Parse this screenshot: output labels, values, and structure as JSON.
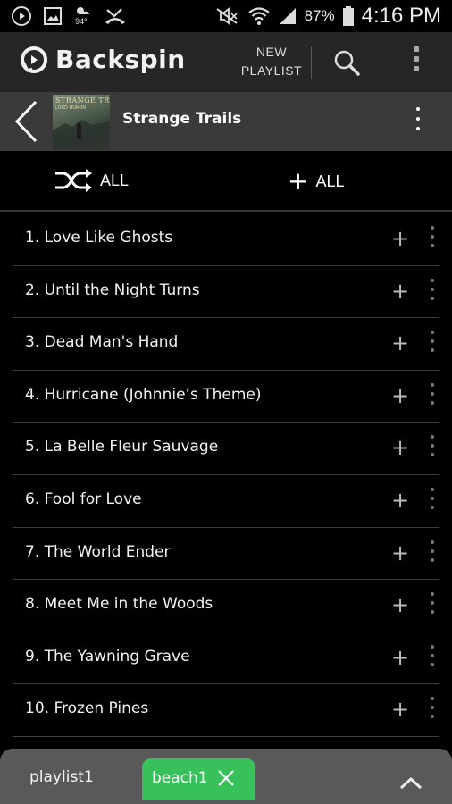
{
  "status_bar": {
    "temperature": "94°",
    "battery_percent": "87%",
    "time": "4:16 PM",
    "icons": [
      "play-circle-icon",
      "image-icon",
      "weather-icon",
      "missed-call-icon",
      "mute-icon",
      "wifi-icon",
      "signal-icon",
      "battery-icon"
    ]
  },
  "app_bar": {
    "logo_text": "Backspin",
    "new_playlist_line1": "NEW",
    "new_playlist_line2": "PLAYLIST",
    "search_icon": "search-icon",
    "overflow_icon": "overflow-menu-icon"
  },
  "album": {
    "title": "Strange Trails",
    "art_title": "STRANGE TRAILS",
    "art_subtitle": "LORD HURON",
    "back_icon": "back-arrow-icon"
  },
  "actions": {
    "shuffle_label": "ALL",
    "add_label": "ALL"
  },
  "tracks": [
    {
      "title": "1. Love Like Ghosts"
    },
    {
      "title": "2. Until the Night Turns"
    },
    {
      "title": "3. Dead Man's Hand"
    },
    {
      "title": "4. Hurricane (Johnnie’s Theme)"
    },
    {
      "title": "5. La Belle Fleur Sauvage"
    },
    {
      "title": "6. Fool for Love"
    },
    {
      "title": "7. The World Ender"
    },
    {
      "title": "8. Meet Me in the Woods"
    },
    {
      "title": "9. The Yawning Grave"
    },
    {
      "title": "10. Frozen Pines"
    }
  ],
  "bottom_bar": {
    "tabs": [
      {
        "label": "playlist1",
        "active": false
      },
      {
        "label": "beach1",
        "active": true
      }
    ],
    "active_color": "#38c05b"
  },
  "colors": {
    "app_bar": "#262626",
    "album_bar": "#3a3a3a",
    "background": "#000000",
    "accent": "#38c05b"
  }
}
